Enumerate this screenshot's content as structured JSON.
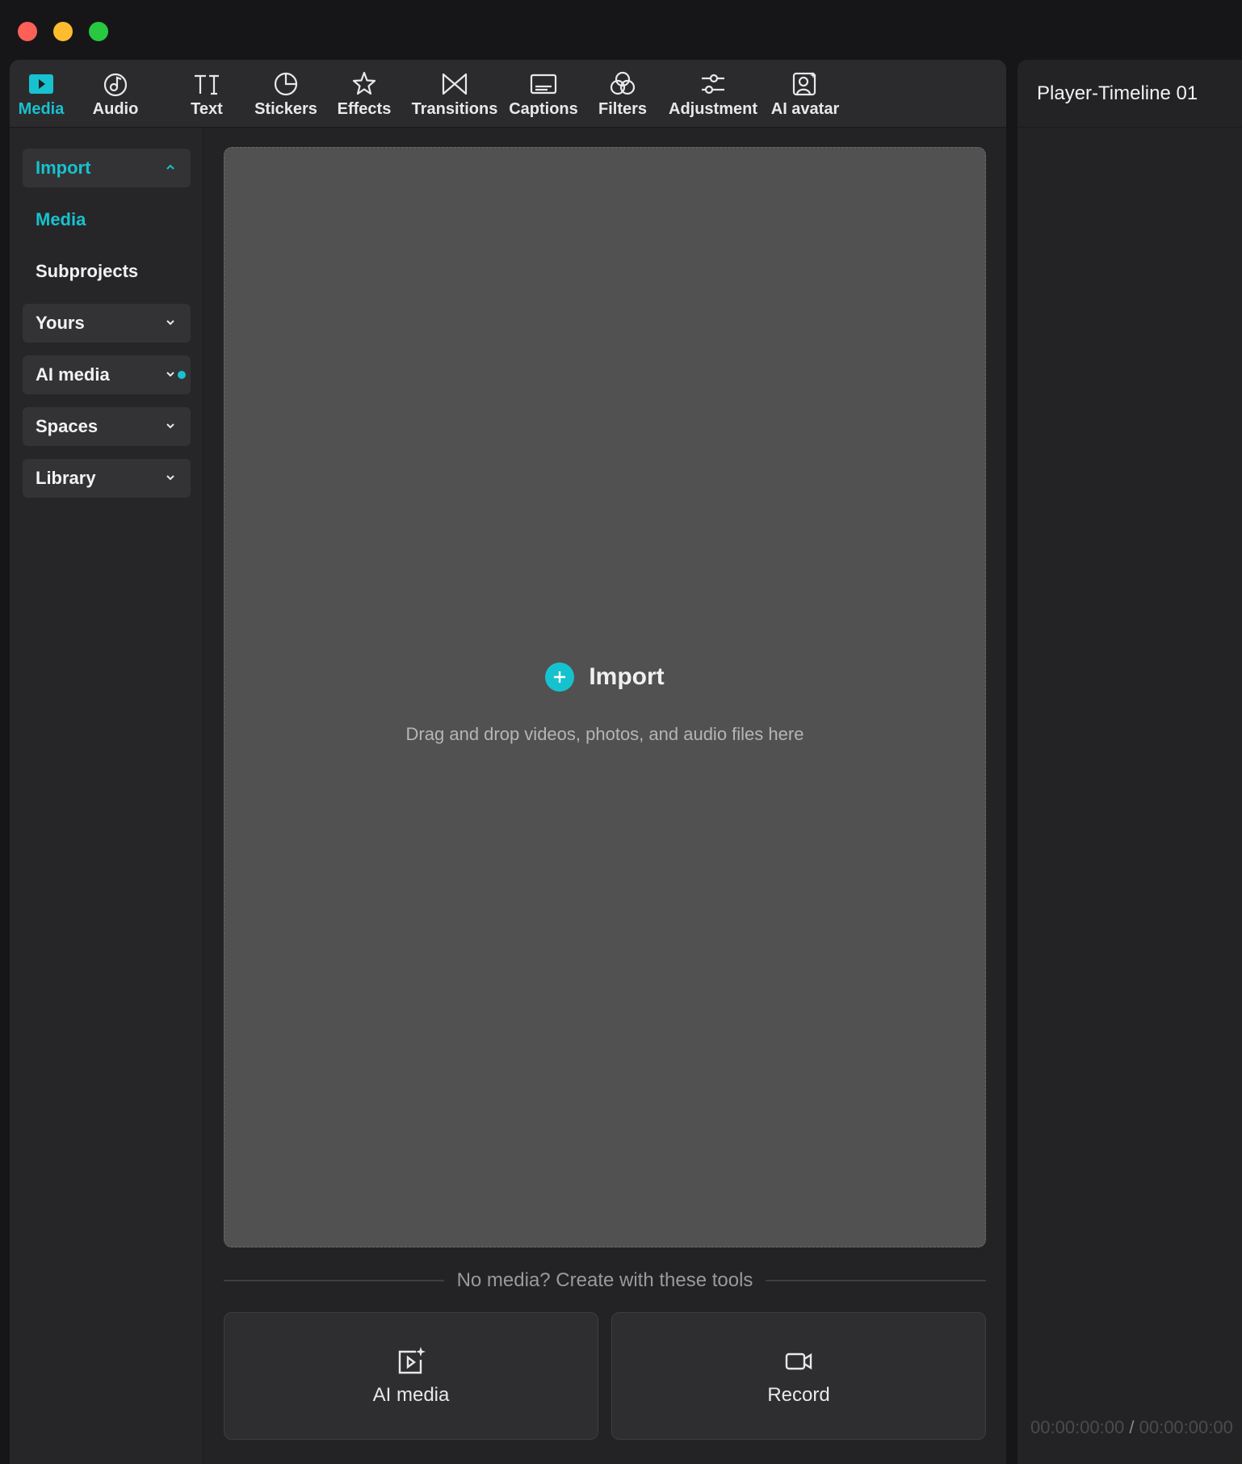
{
  "window": {
    "controls": [
      "close",
      "minimize",
      "maximize"
    ]
  },
  "toolbar": {
    "tabs": [
      {
        "label": "Media",
        "icon": "media-play-icon",
        "active": true
      },
      {
        "label": "Audio",
        "icon": "audio-icon"
      },
      {
        "label": "Text",
        "icon": "text-icon"
      },
      {
        "label": "Stickers",
        "icon": "stickers-icon"
      },
      {
        "label": "Effects",
        "icon": "effects-star-icon"
      },
      {
        "label": "Transitions",
        "icon": "transitions-icon"
      },
      {
        "label": "Captions",
        "icon": "captions-icon"
      },
      {
        "label": "Filters",
        "icon": "filters-icon"
      },
      {
        "label": "Adjustment",
        "icon": "adjustment-sliders-icon"
      },
      {
        "label": "AI avatar",
        "icon": "ai-avatar-icon"
      }
    ]
  },
  "sidebar": {
    "items": [
      {
        "label": "Import",
        "expanded": true
      },
      {
        "label": "Media",
        "selected": true
      },
      {
        "label": "Subprojects"
      },
      {
        "label": "Yours"
      },
      {
        "label": "AI media",
        "has_dot": true
      },
      {
        "label": "Spaces"
      },
      {
        "label": "Library"
      }
    ]
  },
  "dropzone": {
    "title": "Import",
    "hint": "Drag and drop videos, photos, and audio files here"
  },
  "create_tools": {
    "prompt": "No media? Create with these tools",
    "cards": [
      {
        "label": "AI media",
        "icon": "ai-media-icon"
      },
      {
        "label": "Record",
        "icon": "record-camera-icon"
      }
    ]
  },
  "player": {
    "title": "Player-Timeline 01",
    "current_time": "00:00:00:00",
    "separator": "/",
    "total_time": "00:00:00:00"
  },
  "colors": {
    "accent": "#17c2cf",
    "dropzone_bg": "#515151",
    "panel_bg": "#232325"
  }
}
